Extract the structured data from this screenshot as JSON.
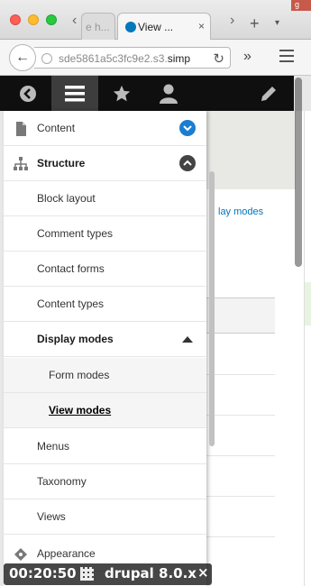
{
  "browser": {
    "tab_inactive_title": "e h...",
    "tab_active_title": "View ...",
    "tab_close": "×",
    "new_tab": "+",
    "url_host": "sde5861a5c3fc9e2.s3.",
    "url_rest": "simp",
    "back": "←",
    "reload": "↻",
    "overflow": "»"
  },
  "toolbar": {
    "items": [
      "back-icon",
      "menu-icon",
      "star-icon",
      "user-icon",
      "pencil-icon"
    ]
  },
  "page_behind": {
    "link": "lay modes"
  },
  "menu": {
    "content": "Content",
    "structure": "Structure",
    "block_layout": "Block layout",
    "comment_types": "Comment types",
    "contact_forms": "Contact forms",
    "content_types": "Content types",
    "display_modes": "Display modes",
    "form_modes": "Form modes",
    "view_modes": "View modes",
    "menus": "Menus",
    "taxonomy": "Taxonomy",
    "views": "Views",
    "appearance": "Appearance"
  },
  "overlay": {
    "time": "00:20:50",
    "host": "drupal 8.0.x",
    "close": "×"
  },
  "colors": {
    "toolbar_bg": "#0f0f0f",
    "toggle_blue": "#1b7ed1",
    "link_blue": "#0074bd"
  }
}
